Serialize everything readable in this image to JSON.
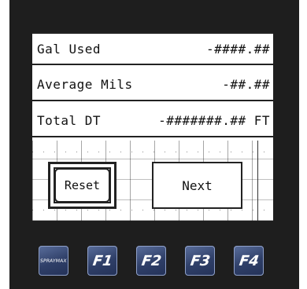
{
  "rows": [
    {
      "label": "Gal Used",
      "value": "-####.##"
    },
    {
      "label": "Average Mils",
      "value": "-##.##"
    },
    {
      "label": "Total DT",
      "value": "-#######.## FT"
    }
  ],
  "buttons": {
    "reset": "Reset",
    "next": "Next"
  },
  "function_keys": [
    "F1",
    "F2",
    "F3",
    "F4"
  ],
  "logo_key_text": "SPRAYMAX",
  "colors": {
    "bezel": "#1e1e1e",
    "screen": "#ffffff",
    "key": "#2f3f68"
  }
}
